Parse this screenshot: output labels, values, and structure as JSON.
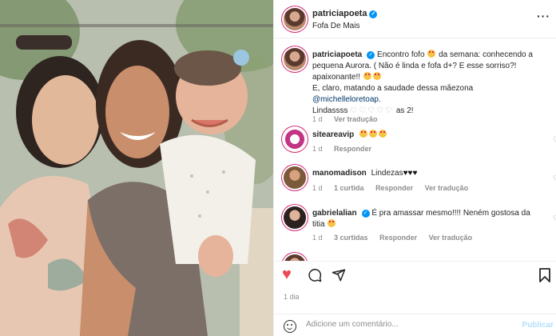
{
  "post": {
    "username": "patriciapoeta",
    "subtitle": "Fofa De Mais",
    "more": "···"
  },
  "comments": [
    {
      "username": "patriciapoeta",
      "line1": "Encontro fofo",
      "line1b": "da semana: conhecendo a",
      "line2": "pequena Aurora. ( Não é linda e fofa d+? E esse sorriso?!",
      "line3": "apaixonante!!",
      "line4": "E, claro, matando a saudade dessa mãezona",
      "mention": "@michelleloretoap.",
      "line5": "Lindassss",
      "line5b": "as 2!",
      "time": "1 d",
      "action1": "Ver tradução"
    },
    {
      "username": "siteareavip",
      "time": "1 d",
      "action1": "Responder"
    },
    {
      "username": "manomadison",
      "text": "Lindezas",
      "time": "1 d",
      "likes": "1 curtida",
      "action1": "Responder",
      "action2": "Ver tradução"
    },
    {
      "username": "gabrielalian",
      "text": "É pra amassar mesmo!!!! Neném gostosa da",
      "text2": "titia",
      "time": "1 d",
      "likes": "3 curtidas",
      "action1": "Responder",
      "action2": "Ver tradução"
    }
  ],
  "footer": {
    "time": "1 dia",
    "comment_placeholder": "Adicione um comentário...",
    "publish": "Publicar"
  },
  "colors": {
    "like_red": "#ed4956",
    "link_blue": "#00376b",
    "verified_blue": "#0095f6",
    "muted": "#8e8e8e"
  },
  "icons": [
    "heart-icon",
    "comment-icon",
    "share-icon",
    "bookmark-icon",
    "emoji-icon",
    "verified-icon",
    "more-icon"
  ]
}
